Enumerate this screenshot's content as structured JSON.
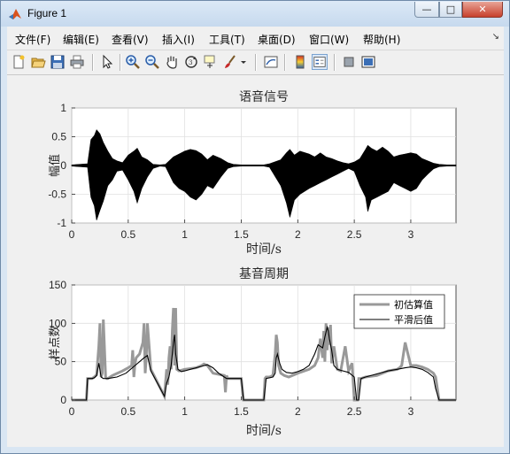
{
  "window": {
    "title": "Figure 1",
    "buttons": {
      "minimize": "—",
      "maximize": "□",
      "close": "✕"
    }
  },
  "menubar": {
    "items": [
      "文件(F)",
      "编辑(E)",
      "查看(V)",
      "插入(I)",
      "工具(T)",
      "桌面(D)",
      "窗口(W)",
      "帮助(H)"
    ],
    "overflow_icon": "dock-arrow-icon"
  },
  "toolbar": {
    "icons": [
      "new-figure-icon",
      "open-file-icon",
      "save-icon",
      "print-icon",
      "pointer-icon",
      "zoom-in-icon",
      "zoom-out-icon",
      "pan-hand-icon",
      "rotate-3d-icon",
      "data-cursor-icon",
      "brush-icon",
      "brush-dropdown-icon",
      "link-plot-icon",
      "colorbar-icon",
      "legend-icon",
      "hide-plot-tools-icon",
      "show-plot-tools-icon"
    ]
  },
  "chart_data": [
    {
      "type": "line",
      "title": "语音信号",
      "xlabel": "",
      "ylabel": "幅值",
      "xlim": [
        0,
        3.4
      ],
      "ylim": [
        -1,
        1
      ],
      "xticks": [
        0,
        0.5,
        1,
        1.5,
        2,
        2.5,
        3
      ],
      "yticks": [
        -1,
        -0.5,
        0,
        0.5,
        1
      ],
      "grid": true,
      "series_color": "#000000",
      "envelope": {
        "x": [
          0.0,
          0.14,
          0.17,
          0.2,
          0.22,
          0.25,
          0.28,
          0.32,
          0.36,
          0.4,
          0.45,
          0.5,
          0.55,
          0.58,
          0.62,
          0.67,
          0.72,
          0.78,
          0.83,
          0.9,
          0.95,
          1.0,
          1.05,
          1.1,
          1.15,
          1.2,
          1.25,
          1.32,
          1.38,
          1.43,
          1.5,
          1.55,
          1.58,
          1.62,
          1.7,
          1.75,
          1.85,
          1.9,
          1.93,
          1.97,
          2.02,
          2.1,
          2.15,
          2.2,
          2.25,
          2.3,
          2.35,
          2.4,
          2.45,
          2.5,
          2.55,
          2.6,
          2.62,
          2.65,
          2.7,
          2.75,
          2.8,
          2.85,
          2.9,
          2.95,
          3.0,
          3.05,
          3.1,
          3.15,
          3.2,
          3.25,
          3.32,
          3.4
        ],
        "upper": [
          0.01,
          0.03,
          0.45,
          0.52,
          0.62,
          0.55,
          0.4,
          0.25,
          0.12,
          0.08,
          0.05,
          0.18,
          0.25,
          0.3,
          0.15,
          0.1,
          0.02,
          0.01,
          0.02,
          0.15,
          0.2,
          0.25,
          0.28,
          0.26,
          0.2,
          0.1,
          0.18,
          0.12,
          0.05,
          0.02,
          0.01,
          0.01,
          0.01,
          0.01,
          0.01,
          0.03,
          0.1,
          0.22,
          0.28,
          0.18,
          0.25,
          0.2,
          0.15,
          0.22,
          0.15,
          0.12,
          0.08,
          0.05,
          0.03,
          0.06,
          0.12,
          0.28,
          0.35,
          0.3,
          0.25,
          0.32,
          0.25,
          0.15,
          0.18,
          0.2,
          0.22,
          0.2,
          0.12,
          0.08,
          0.04,
          0.02,
          0.01,
          0.01
        ],
        "lower": [
          -0.01,
          -0.03,
          -0.55,
          -0.7,
          -0.95,
          -0.78,
          -0.62,
          -0.35,
          -0.25,
          -0.1,
          -0.08,
          -0.25,
          -0.45,
          -0.65,
          -0.4,
          -0.2,
          -0.05,
          -0.01,
          -0.02,
          -0.3,
          -0.4,
          -0.45,
          -0.55,
          -0.6,
          -0.5,
          -0.35,
          -0.4,
          -0.2,
          -0.05,
          -0.02,
          -0.01,
          -0.01,
          -0.01,
          -0.01,
          -0.01,
          -0.03,
          -0.35,
          -0.65,
          -0.9,
          -0.6,
          -0.5,
          -0.4,
          -0.35,
          -0.3,
          -0.25,
          -0.2,
          -0.15,
          -0.1,
          -0.05,
          -0.1,
          -0.35,
          -0.55,
          -0.8,
          -0.6,
          -0.55,
          -0.5,
          -0.45,
          -0.3,
          -0.35,
          -0.4,
          -0.45,
          -0.4,
          -0.25,
          -0.15,
          -0.06,
          -0.02,
          -0.01,
          -0.01
        ]
      }
    },
    {
      "type": "line",
      "title": "基音周期",
      "xlabel": "时间/s",
      "ylabel": "样点数",
      "xlim": [
        0,
        3.4
      ],
      "ylim": [
        0,
        150
      ],
      "xticks": [
        0,
        0.5,
        1,
        1.5,
        2,
        2.5,
        3
      ],
      "yticks": [
        0,
        50,
        100,
        150
      ],
      "grid": true,
      "legend_position": "top-right",
      "series": [
        {
          "name": "初估算值",
          "color": "#999999",
          "x": [
            0.0,
            0.13,
            0.14,
            0.18,
            0.2,
            0.22,
            0.24,
            0.25,
            0.26,
            0.27,
            0.28,
            0.3,
            0.31,
            0.32,
            0.33,
            0.34,
            0.36,
            0.45,
            0.5,
            0.53,
            0.54,
            0.55,
            0.56,
            0.57,
            0.6,
            0.63,
            0.64,
            0.65,
            0.66,
            0.67,
            0.7,
            0.82,
            0.83,
            0.84,
            0.85,
            0.86,
            0.87,
            0.88,
            0.89,
            0.9,
            0.91,
            0.92,
            0.93,
            0.95,
            1.0,
            1.1,
            1.15,
            1.17,
            1.2,
            1.25,
            1.35,
            1.36,
            1.37,
            1.38,
            1.4,
            1.5,
            1.52,
            1.58,
            1.7,
            1.71,
            1.72,
            1.73,
            1.75,
            1.78,
            1.8,
            1.81,
            1.82,
            1.83,
            1.85,
            1.88,
            1.92,
            1.97,
            2.0,
            2.1,
            2.15,
            2.18,
            2.2,
            2.22,
            2.23,
            2.24,
            2.25,
            2.26,
            2.27,
            2.28,
            2.29,
            2.3,
            2.32,
            2.35,
            2.38,
            2.42,
            2.45,
            2.48,
            2.5,
            2.52,
            2.53,
            2.54,
            2.56,
            2.6,
            2.7,
            2.8,
            2.88,
            2.9,
            2.92,
            2.95,
            3.0,
            3.05,
            3.1,
            3.15,
            3.2,
            3.22,
            3.25,
            3.4
          ],
          "values": [
            0,
            0,
            28,
            28,
            30,
            33,
            70,
            100,
            30,
            35,
            105,
            30,
            28,
            28,
            29,
            30,
            32,
            38,
            42,
            45,
            65,
            30,
            48,
            55,
            60,
            75,
            100,
            35,
            55,
            100,
            40,
            5,
            22,
            40,
            20,
            55,
            70,
            40,
            90,
            120,
            45,
            120,
            40,
            38,
            40,
            42,
            45,
            47,
            45,
            35,
            32,
            10,
            32,
            28,
            28,
            28,
            0,
            0,
            0,
            28,
            30,
            30,
            30,
            32,
            60,
            85,
            75,
            45,
            35,
            32,
            30,
            33,
            35,
            40,
            45,
            55,
            80,
            55,
            90,
            50,
            100,
            65,
            95,
            72,
            98,
            48,
            70,
            40,
            38,
            70,
            38,
            48,
            0,
            0,
            0,
            28,
            28,
            30,
            32,
            38,
            40,
            42,
            45,
            75,
            45,
            45,
            43,
            40,
            35,
            30,
            0,
            0
          ]
        },
        {
          "name": "平滑后值",
          "color": "#000000",
          "x": [
            0.0,
            0.13,
            0.14,
            0.18,
            0.2,
            0.22,
            0.24,
            0.26,
            0.28,
            0.32,
            0.4,
            0.48,
            0.52,
            0.56,
            0.6,
            0.64,
            0.67,
            0.7,
            0.82,
            0.84,
            0.86,
            0.88,
            0.9,
            0.91,
            0.92,
            0.94,
            0.97,
            1.0,
            1.05,
            1.1,
            1.15,
            1.2,
            1.25,
            1.3,
            1.35,
            1.37,
            1.4,
            1.5,
            1.52,
            1.58,
            1.7,
            1.72,
            1.75,
            1.78,
            1.8,
            1.81,
            1.82,
            1.84,
            1.86,
            1.9,
            1.95,
            2.0,
            2.05,
            2.1,
            2.15,
            2.18,
            2.2,
            2.22,
            2.24,
            2.26,
            2.27,
            2.28,
            2.3,
            2.32,
            2.35,
            2.4,
            2.45,
            2.5,
            2.52,
            2.54,
            2.56,
            2.6,
            2.7,
            2.8,
            2.88,
            2.95,
            3.0,
            3.05,
            3.1,
            3.15,
            3.2,
            3.22,
            3.25,
            3.4
          ],
          "values": [
            0,
            0,
            28,
            28,
            29,
            32,
            48,
            30,
            28,
            28,
            30,
            35,
            40,
            45,
            50,
            55,
            58,
            38,
            5,
            22,
            30,
            45,
            75,
            85,
            60,
            40,
            37,
            38,
            40,
            42,
            44,
            46,
            42,
            35,
            30,
            28,
            28,
            28,
            0,
            0,
            0,
            28,
            29,
            30,
            35,
            55,
            60,
            48,
            40,
            36,
            35,
            37,
            40,
            45,
            60,
            72,
            70,
            68,
            82,
            95,
            90,
            80,
            65,
            45,
            40,
            38,
            36,
            30,
            0,
            0,
            28,
            30,
            34,
            38,
            40,
            42,
            43,
            42,
            40,
            36,
            30,
            15,
            0,
            0
          ]
        }
      ]
    }
  ]
}
